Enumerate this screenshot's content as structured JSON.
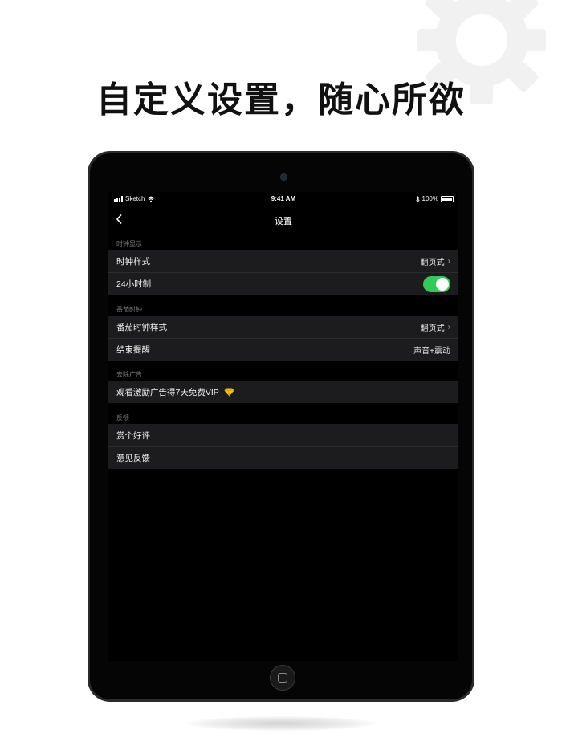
{
  "headline": "自定义设置，随心所欲",
  "status_bar": {
    "carrier": "Sketch",
    "time": "9:41 AM",
    "battery": "100%"
  },
  "nav": {
    "title": "设置",
    "back_icon": "chevron-left-icon"
  },
  "sections": [
    {
      "header": "时钟显示",
      "rows": [
        {
          "label": "时钟样式",
          "value": "翻页式",
          "has_chevron": true
        },
        {
          "label": "24小时制",
          "toggle": true
        }
      ]
    },
    {
      "header": "番茄时钟",
      "rows": [
        {
          "label": "番茄时钟样式",
          "value": "翻页式",
          "has_chevron": true
        },
        {
          "label": "结束提醒",
          "value": "声音+震动"
        }
      ]
    },
    {
      "header": "去除广告",
      "rows": [
        {
          "label": "观看激励广告得7天免费VIP",
          "icon": "diamond-icon"
        }
      ]
    },
    {
      "header": "反馈",
      "rows": [
        {
          "label": "赏个好评"
        },
        {
          "label": "意见反馈"
        }
      ]
    }
  ],
  "colors": {
    "toggle_on": "#34c759",
    "group_bg": "#1c1c1e",
    "screen_bg": "#000000",
    "diamond": "#f5c518"
  }
}
